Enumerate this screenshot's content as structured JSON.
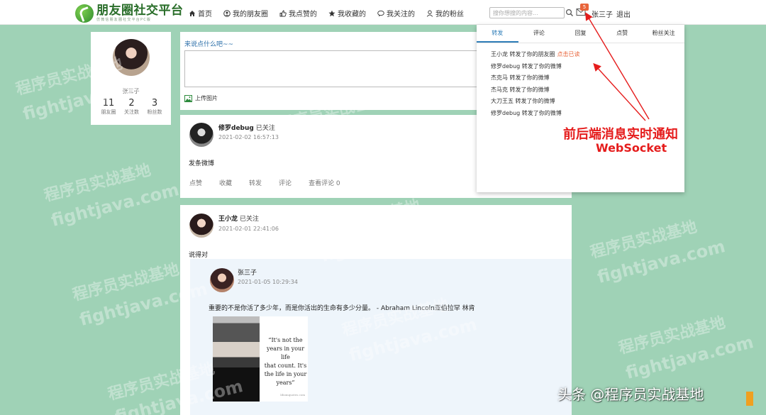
{
  "brand": {
    "title": "朋友圈社交平台",
    "subtitle": "仿微信朋友圈社交平台PC版"
  },
  "nav": {
    "items": [
      {
        "label": "首页",
        "icon": "home-icon"
      },
      {
        "label": "我的朋友圈",
        "icon": "user-circle-icon"
      },
      {
        "label": "我点赞的",
        "icon": "thumb-up-icon"
      },
      {
        "label": "我收藏的",
        "icon": "star-icon"
      },
      {
        "label": "我关注的",
        "icon": "chat-icon"
      },
      {
        "label": "我的粉丝",
        "icon": "user-icon"
      }
    ]
  },
  "header": {
    "search_placeholder": "搜你想搜的内容...",
    "mail_badge": "5",
    "user_name": "张三子",
    "logout": "退出"
  },
  "profile": {
    "name": "张三子",
    "stats": [
      {
        "num": "11",
        "label": "朋友圈"
      },
      {
        "num": "2",
        "label": "关注数"
      },
      {
        "num": "3",
        "label": "粉丝数"
      }
    ]
  },
  "compose": {
    "prompt": "来说点什么吧~~",
    "upload_label": "上传图片"
  },
  "posts": [
    {
      "author": "修罗debug",
      "follow": "已关注",
      "time": "2021-02-02 16:57:13",
      "content": "发条微博",
      "actions": [
        "点赞",
        "收藏",
        "转发",
        "评论",
        "查看评论 0"
      ]
    },
    {
      "author": "王小龙",
      "follow": "已关注",
      "time": "2021-02-01 22:41:06",
      "content": "说得对",
      "repost": {
        "author": "张三子",
        "time": "2021-01-05 10:29:34",
        "content": "重要的不是你活了多少年，而是你活出的生命有多少分量。 - Abraham Lincoln亚伯拉罕 林肯",
        "image_quote": [
          "“It's not the",
          "years in your life",
          "that count. It's",
          "the life in your",
          "years”"
        ],
        "image_credit": "Idiomquotes.com"
      }
    }
  ],
  "notifications": {
    "tabs": [
      "转发",
      "评论",
      "回复",
      "点赞",
      "粉丝关注"
    ],
    "active_tab": 0,
    "items": [
      {
        "text": "王小龙 转发了你的朋友圈",
        "action": "点击已读"
      },
      {
        "text": "修罗debug 转发了你的微博",
        "action": ""
      },
      {
        "text": "杰克马 转发了你的微博",
        "action": ""
      },
      {
        "text": "杰马克 转发了你的微博",
        "action": ""
      },
      {
        "text": "大刀王五 转发了你的微博",
        "action": ""
      },
      {
        "text": "修罗debug 转发了你的微博",
        "action": ""
      }
    ]
  },
  "annotation": {
    "title": "前后端消息实时通知",
    "subtitle": "WebSocket"
  },
  "watermark": {
    "cn": "程序员实战基地",
    "en": "fightjava.com"
  },
  "footer_credit": "头条 @程序员实战基地",
  "colors": {
    "background": "#9fd2b6",
    "accent_blue": "#2e7db8",
    "badge_orange": "#e8643a",
    "annotation_red": "#e51c1c"
  }
}
